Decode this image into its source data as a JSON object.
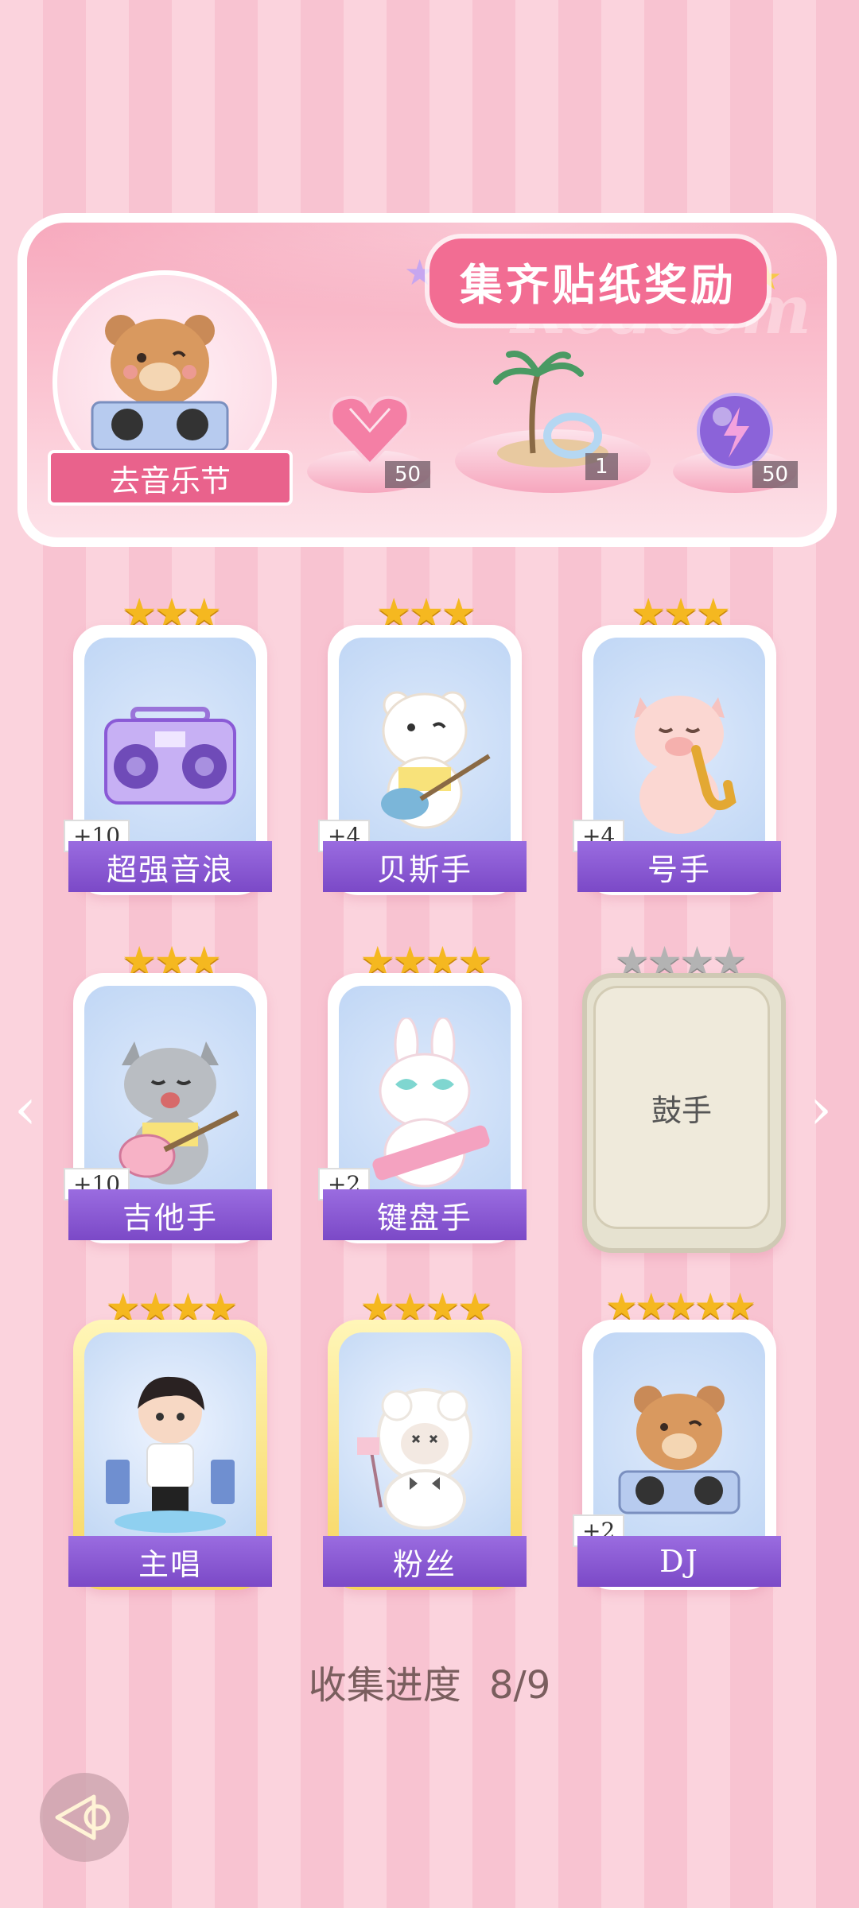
{
  "banner": {
    "title": "集齐贴纸奖励",
    "watermark": "Redeem",
    "festival_button": "去音乐节",
    "rewards": [
      {
        "icon": "pink-heart-gem-icon",
        "count": "50"
      },
      {
        "icon": "palm-island-icon",
        "count": "1"
      },
      {
        "icon": "purple-energy-orb-icon",
        "count": "50"
      }
    ]
  },
  "cards": [
    {
      "name": "超强音浪",
      "bonus": "+10",
      "stars": 3,
      "art": "boombox-icon"
    },
    {
      "name": "贝斯手",
      "bonus": "+4",
      "stars": 3,
      "art": "bear-bass-icon"
    },
    {
      "name": "号手",
      "bonus": "+4",
      "stars": 3,
      "art": "pig-saxophone-icon"
    },
    {
      "name": "吉他手",
      "bonus": "+10",
      "stars": 3,
      "art": "cat-guitar-icon"
    },
    {
      "name": "键盘手",
      "bonus": "+2",
      "stars": 4,
      "art": "bunny-keytar-icon"
    },
    {
      "name": "鼓手",
      "bonus": "",
      "stars": 4,
      "art": "locked-card",
      "locked": true
    },
    {
      "name": "主唱",
      "bonus": "",
      "stars": 4,
      "art": "singer-boy-icon"
    },
    {
      "name": "粉丝",
      "bonus": "",
      "stars": 4,
      "art": "sheep-fan-icon"
    },
    {
      "name": "DJ",
      "bonus": "+2",
      "stars": 5,
      "art": "bear-dj-icon"
    }
  ],
  "progress": {
    "label": "收集进度",
    "value": "8/9"
  },
  "colors": {
    "accent": "#f26d93",
    "label_purple": "#8a5ad6",
    "star_gold": "#f5b820"
  }
}
